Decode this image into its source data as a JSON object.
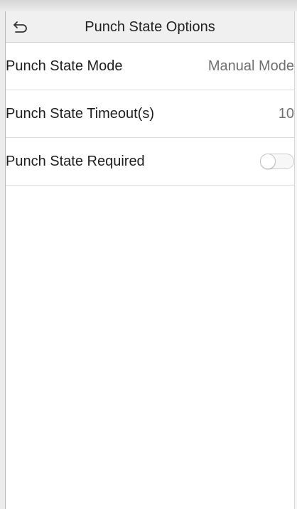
{
  "header": {
    "back_icon": "back-arrow-icon",
    "title": "Punch State Options"
  },
  "settings": [
    {
      "label": "Punch State Mode",
      "value": "Manual Mode",
      "type": "value"
    },
    {
      "label": "Punch State Timeout(s)",
      "value": "10",
      "type": "value"
    },
    {
      "label": "Punch State Required",
      "type": "toggle",
      "on": false
    }
  ],
  "colors": {
    "header_bg": "#f0f0f0",
    "divider": "#dcdcdc",
    "value_text": "#707070"
  }
}
